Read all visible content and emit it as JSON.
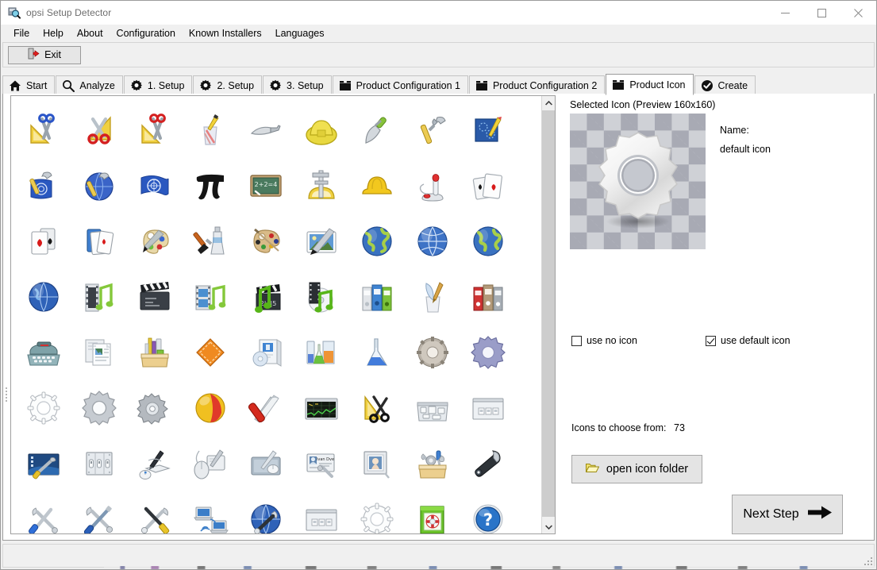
{
  "window": {
    "title": "opsi Setup Detector",
    "app_icon": "app-magnifier-icon",
    "controls": {
      "minimize": "minimize-icon",
      "maximize": "maximize-icon",
      "close": "close-icon"
    }
  },
  "menubar": {
    "items": [
      {
        "label": "File"
      },
      {
        "label": "Help"
      },
      {
        "label": "About"
      },
      {
        "label": "Configuration"
      },
      {
        "label": "Known Installers"
      },
      {
        "label": "Languages"
      }
    ]
  },
  "toolbar": {
    "exit_label": "Exit",
    "exit_icon": "exit-door-icon"
  },
  "tabs": [
    {
      "label": "Start",
      "icon": "home-icon",
      "active": false
    },
    {
      "label": "Analyze",
      "icon": "magnifier-icon",
      "active": false
    },
    {
      "label": "1. Setup",
      "icon": "gear-icon",
      "active": false
    },
    {
      "label": "2. Setup",
      "icon": "gear-icon",
      "active": false
    },
    {
      "label": "3. Setup",
      "icon": "gear-icon",
      "active": false
    },
    {
      "label": "Product Configuration 1",
      "icon": "box-icon",
      "active": false
    },
    {
      "label": "Product Configuration 2",
      "icon": "box-icon",
      "active": false
    },
    {
      "label": "Product Icon",
      "icon": "box-icon",
      "active": true
    },
    {
      "label": "Create",
      "icon": "check-circle-icon",
      "active": false
    }
  ],
  "right_panel": {
    "preview_title": "Selected Icon (Preview 160x160)",
    "name_label": "Name:",
    "name_value": "default icon",
    "preview_icon": "default-gear-icon",
    "checkbox_no_icon": {
      "label": "use no icon",
      "checked": false
    },
    "checkbox_default_icon": {
      "label": "use default icon",
      "checked": true
    },
    "open_folder_button": {
      "label": "open icon folder",
      "icon": "open-folder-icon"
    },
    "icons_count_label": "Icons to choose from:",
    "icons_count_value": "73",
    "next_step_button": {
      "label": "Next Step",
      "icon": "arrow-right-icon"
    }
  },
  "icon_grid": {
    "scrollbar": {
      "up": "chevron-up-icon",
      "down": "chevron-down-icon"
    },
    "columns": 9,
    "items": [
      {
        "name": "ruler-scissors-blue-icon"
      },
      {
        "name": "scissors-red-ruler-icon"
      },
      {
        "name": "ruler-scissors-red-icon"
      },
      {
        "name": "pencil-cup-icon"
      },
      {
        "name": "trowel-icon"
      },
      {
        "name": "hardhat-yellow-icon"
      },
      {
        "name": "trowel-green-handle-icon"
      },
      {
        "name": "hammer-icon"
      },
      {
        "name": "blueprint-pencil-icon"
      },
      {
        "name": "hammer-un-flag-icon"
      },
      {
        "name": "hammer-globe-icon"
      },
      {
        "name": "un-flag-icon"
      },
      {
        "name": "pi-symbol-icon"
      },
      {
        "name": "blackboard-math-icon"
      },
      {
        "name": "caliper-protractor-icon"
      },
      {
        "name": "hardhat-icon"
      },
      {
        "name": "joystick-icon"
      },
      {
        "name": "playing-cards-icon"
      },
      {
        "name": "cards-hearts-spades-icon"
      },
      {
        "name": "card-deck-icon"
      },
      {
        "name": "palette-brush-icon"
      },
      {
        "name": "brush-paint-tube-icon"
      },
      {
        "name": "wood-palette-icon"
      },
      {
        "name": "image-brush-icon"
      },
      {
        "name": "globe-green-icon"
      },
      {
        "name": "globe-blue-wire-icon"
      },
      {
        "name": "globe-green-2-icon"
      },
      {
        "name": "globe-blue-icon"
      },
      {
        "name": "filmstrip-note-icon"
      },
      {
        "name": "clapperboard-icon"
      },
      {
        "name": "film-music-icon"
      },
      {
        "name": "clapper-note-icon"
      },
      {
        "name": "media-disc-note-icon"
      },
      {
        "name": "binders-blue-green-icon"
      },
      {
        "name": "pen-brush-cup-icon"
      },
      {
        "name": "binders-red-grey-icon"
      },
      {
        "name": "typewriter-icon"
      },
      {
        "name": "documents-icon"
      },
      {
        "name": "supplies-box-icon"
      },
      {
        "name": "orange-diamond-icon"
      },
      {
        "name": "software-box-cd-icon"
      },
      {
        "name": "lab-beakers-icon"
      },
      {
        "name": "flask-blue-icon"
      },
      {
        "name": "gear-metal-icon"
      },
      {
        "name": "gear-purple-icon"
      },
      {
        "name": "gear-outline-icon"
      },
      {
        "name": "gear-silver-icon"
      },
      {
        "name": "gears-small-icon"
      },
      {
        "name": "beach-ball-icon"
      },
      {
        "name": "swiss-knife-icon"
      },
      {
        "name": "monitor-graph-icon"
      },
      {
        "name": "ruler-scissors-black-icon"
      },
      {
        "name": "keyboard-keys-icon"
      },
      {
        "name": "network-panel-icon"
      },
      {
        "name": "desktop-tools-icon"
      },
      {
        "name": "switches-panel-icon"
      },
      {
        "name": "tablet-pen-mouse-icon"
      },
      {
        "name": "mouse-tablet-icon"
      },
      {
        "name": "tablet-stylus-mouse-icon"
      },
      {
        "name": "id-card-wrench-icon"
      },
      {
        "name": "photo-frame-icon"
      },
      {
        "name": "toolbox-icon"
      },
      {
        "name": "wrench-icon"
      },
      {
        "name": "screwdriver-wrench-icon"
      },
      {
        "name": "wrench-screwdriver-blue-icon"
      },
      {
        "name": "wrench-screwdriver-yellow-icon"
      },
      {
        "name": "network-laptops-icon"
      },
      {
        "name": "globe-wrench-icon"
      },
      {
        "name": "network-panel-2-icon"
      },
      {
        "name": "gear-outline-2-icon"
      },
      {
        "name": "help-book-icon"
      },
      {
        "name": "help-question-icon"
      }
    ]
  }
}
